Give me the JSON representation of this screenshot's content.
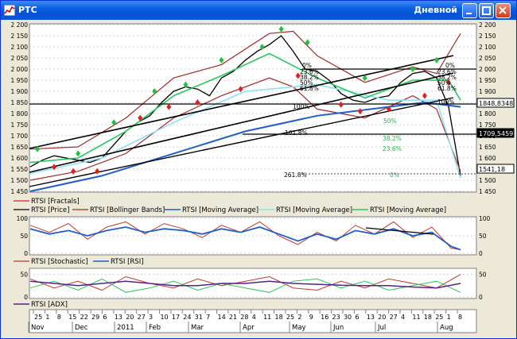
{
  "window": {
    "title": "РТС",
    "subtitle": "Дневной",
    "buttons": {
      "minimize": "minimize",
      "maximize": "maximize",
      "close": "close"
    }
  },
  "colors": {
    "price": "#000000",
    "bollinger": "#a42a2a",
    "ma_long": "#1f5fc8",
    "ma_mid": "#8fe0f0",
    "ma_short": "#28c860",
    "fractal_up": "#20c040",
    "fractal_down": "#e02020",
    "stochastic": "#c0392b",
    "rsi": "#1f5fc8",
    "adx_line": "#5a1f8a"
  },
  "chart_data": [
    {
      "type": "line",
      "panel": "price",
      "ylim": [
        1450,
        2200
      ],
      "y_ticks": [
        "2 200",
        "2 150",
        "2 100",
        "2 050",
        "2 000",
        "1 950",
        "1 900",
        "1 850",
        "1 800",
        "1 750",
        "1 700",
        "1 650",
        "1 600",
        "1 550",
        "1 500",
        "1 450"
      ],
      "y_tick_values": [
        2200,
        2150,
        2100,
        2050,
        2000,
        1950,
        1900,
        1850,
        1800,
        1750,
        1700,
        1650,
        1600,
        1550,
        1500,
        1450
      ],
      "legend": [
        "RTSI [Fractals]",
        "RTSI [Price]",
        "RTSI [Bollinger Bands]",
        "RTSI [Moving Average]",
        "RTSI [Moving Average]",
        "RTSI [Moving Average]"
      ],
      "price_labels": [
        "1848,8348",
        "1709,5459",
        "1541,18"
      ],
      "fib_labels": [
        "0%",
        "23.6%",
        "38.2%",
        "50%",
        "61.8%",
        "100%",
        "161.8%",
        "261.8%",
        "0%",
        "23.6%",
        "38.2%",
        "50%",
        "61.8%",
        "100%",
        "0%",
        "23.6%",
        "38.2%",
        "50%"
      ],
      "series": [
        {
          "role": "price",
          "x": [
            0,
            5,
            10,
            15,
            20,
            25,
            30,
            35,
            40,
            45,
            50,
            55,
            60,
            65,
            70,
            75,
            80,
            85,
            90,
            95,
            100,
            105,
            110,
            115,
            120,
            125,
            130,
            135,
            140,
            145,
            150,
            155,
            160,
            165,
            170,
            175,
            180
          ],
          "values": [
            1560,
            1590,
            1610,
            1600,
            1590,
            1580,
            1600,
            1660,
            1720,
            1760,
            1790,
            1850,
            1900,
            1920,
            1910,
            1880,
            1960,
            1990,
            2040,
            2080,
            2110,
            2150,
            2080,
            2000,
            1990,
            1950,
            1890,
            1860,
            1850,
            1870,
            1880,
            1940,
            1980,
            1990,
            1960,
            1830,
            1520
          ]
        },
        {
          "role": "bollinger_upper",
          "x": [
            0,
            20,
            40,
            60,
            80,
            100,
            110,
            120,
            140,
            160,
            170,
            180
          ],
          "values": [
            1640,
            1650,
            1780,
            1960,
            2020,
            2160,
            2170,
            2060,
            1940,
            2010,
            1980,
            2160
          ]
        },
        {
          "role": "bollinger_lower",
          "x": [
            0,
            20,
            40,
            60,
            80,
            100,
            110,
            120,
            140,
            160,
            170,
            180
          ],
          "values": [
            1500,
            1540,
            1620,
            1780,
            1880,
            1960,
            1920,
            1820,
            1780,
            1880,
            1820,
            1540
          ]
        },
        {
          "role": "ma_long",
          "x": [
            0,
            30,
            60,
            90,
            120,
            150,
            165,
            180
          ],
          "values": [
            1450,
            1520,
            1620,
            1720,
            1790,
            1830,
            1850,
            1830
          ]
        },
        {
          "role": "ma_mid",
          "x": [
            0,
            30,
            60,
            90,
            120,
            150,
            170,
            180
          ],
          "values": [
            1530,
            1600,
            1760,
            1900,
            1930,
            1860,
            1860,
            1510
          ]
        },
        {
          "role": "ma_short",
          "x": [
            0,
            20,
            40,
            60,
            80,
            100,
            120,
            140,
            160,
            175,
            180
          ],
          "values": [
            1580,
            1600,
            1720,
            1880,
            1970,
            2070,
            1960,
            1870,
            1950,
            1950,
            1860
          ]
        }
      ],
      "fractals_up": [
        {
          "x": 3,
          "y": 1640
        },
        {
          "x": 20,
          "y": 1620
        },
        {
          "x": 35,
          "y": 1760
        },
        {
          "x": 52,
          "y": 1900
        },
        {
          "x": 65,
          "y": 1930
        },
        {
          "x": 80,
          "y": 2040
        },
        {
          "x": 97,
          "y": 2100
        },
        {
          "x": 105,
          "y": 2180
        },
        {
          "x": 116,
          "y": 2120
        },
        {
          "x": 140,
          "y": 1960
        },
        {
          "x": 160,
          "y": 2000
        },
        {
          "x": 170,
          "y": 2040
        }
      ],
      "fractals_down": [
        {
          "x": 10,
          "y": 1560
        },
        {
          "x": 18,
          "y": 1540
        },
        {
          "x": 28,
          "y": 1540
        },
        {
          "x": 46,
          "y": 1780
        },
        {
          "x": 58,
          "y": 1830
        },
        {
          "x": 70,
          "y": 1850
        },
        {
          "x": 88,
          "y": 1910
        },
        {
          "x": 112,
          "y": 1970
        },
        {
          "x": 130,
          "y": 1840
        },
        {
          "x": 138,
          "y": 1810
        },
        {
          "x": 150,
          "y": 1820
        },
        {
          "x": 165,
          "y": 1880
        },
        {
          "x": 175,
          "y": 1940
        }
      ]
    },
    {
      "type": "line",
      "panel": "oscillator",
      "ylim": [
        0,
        100
      ],
      "y_ticks": [
        "100",
        "50",
        "0"
      ],
      "y_tick_values": [
        100,
        50,
        0
      ],
      "legend": [
        "RTSI [Stochastic]",
        "RTSI [RSI]"
      ],
      "series": [
        {
          "role": "stochastic",
          "x": [
            0,
            8,
            16,
            24,
            32,
            40,
            48,
            56,
            64,
            72,
            80,
            88,
            96,
            104,
            112,
            120,
            128,
            136,
            144,
            152,
            160,
            168,
            176,
            180
          ],
          "values": [
            80,
            60,
            85,
            40,
            75,
            90,
            55,
            85,
            70,
            45,
            80,
            60,
            90,
            50,
            25,
            60,
            35,
            80,
            55,
            90,
            45,
            75,
            15,
            10
          ]
        },
        {
          "role": "rsi",
          "x": [
            0,
            8,
            16,
            24,
            32,
            40,
            48,
            56,
            64,
            72,
            80,
            88,
            96,
            104,
            112,
            120,
            128,
            136,
            144,
            152,
            160,
            168,
            176,
            180
          ],
          "values": [
            70,
            55,
            65,
            50,
            65,
            75,
            60,
            70,
            65,
            55,
            70,
            60,
            75,
            55,
            35,
            55,
            40,
            65,
            55,
            70,
            50,
            60,
            20,
            10
          ]
        }
      ]
    },
    {
      "type": "line",
      "panel": "adx",
      "ylim": [
        0,
        60
      ],
      "y_ticks": [
        "50",
        "0"
      ],
      "y_tick_values": [
        50,
        0
      ],
      "legend": [
        "RTSI [ADX]"
      ],
      "series": [
        {
          "role": "adx_plus",
          "x": [
            0,
            10,
            20,
            30,
            40,
            50,
            60,
            70,
            80,
            90,
            100,
            110,
            120,
            130,
            140,
            150,
            160,
            170,
            180
          ],
          "values": [
            40,
            20,
            35,
            15,
            45,
            30,
            20,
            40,
            25,
            35,
            45,
            20,
            15,
            35,
            20,
            40,
            30,
            20,
            50
          ]
        },
        {
          "role": "adx_minus",
          "x": [
            0,
            10,
            20,
            30,
            40,
            50,
            60,
            70,
            80,
            90,
            100,
            110,
            120,
            130,
            140,
            150,
            160,
            170,
            180
          ],
          "values": [
            20,
            35,
            15,
            40,
            10,
            20,
            35,
            15,
            30,
            20,
            10,
            35,
            40,
            20,
            35,
            15,
            25,
            35,
            10
          ]
        },
        {
          "role": "adx",
          "x": [
            0,
            10,
            20,
            30,
            40,
            50,
            60,
            70,
            80,
            90,
            100,
            110,
            120,
            130,
            140,
            150,
            160,
            170,
            180
          ],
          "values": [
            35,
            30,
            25,
            30,
            35,
            30,
            25,
            25,
            30,
            30,
            35,
            30,
            28,
            26,
            25,
            25,
            22,
            20,
            30
          ]
        }
      ]
    }
  ],
  "x_axis": {
    "days": [
      "25",
      "1",
      "8",
      "15",
      "22",
      "29",
      "6",
      "13",
      "20",
      "27",
      "3",
      "10",
      "17",
      "24",
      "31",
      "7",
      "14",
      "21",
      "28",
      "4",
      "11",
      "18",
      "25",
      "2",
      "9",
      "16",
      "23",
      "30",
      "6",
      "13",
      "20",
      "27",
      "4",
      "11",
      "18",
      "25",
      "1",
      "8"
    ],
    "months": [
      "Nov",
      "Dec",
      "2011",
      "Feb",
      "Mar",
      "Apr",
      "May",
      "Jun",
      "Jul",
      "Aug"
    ]
  }
}
